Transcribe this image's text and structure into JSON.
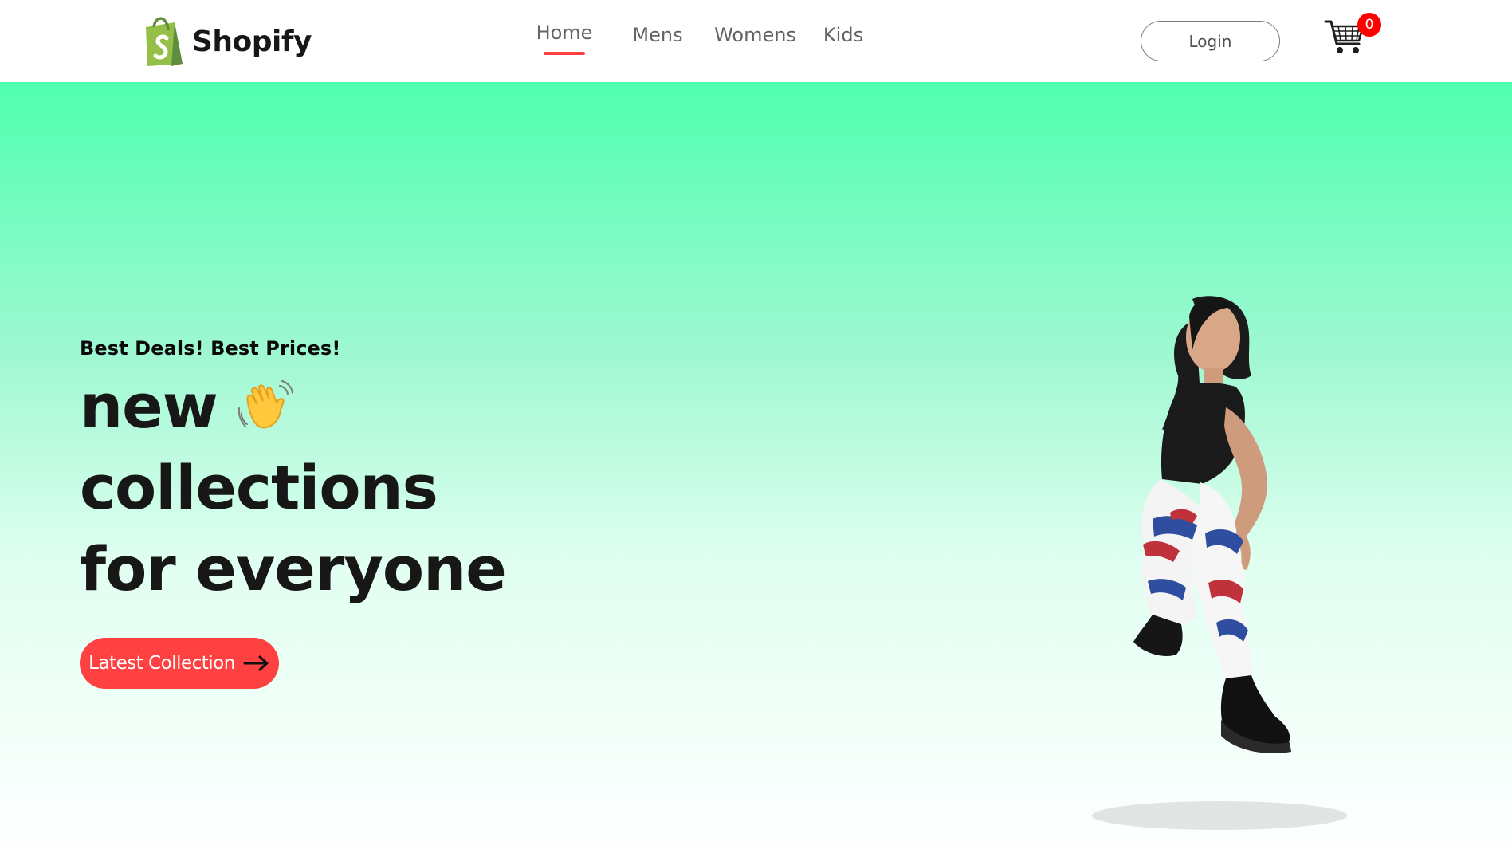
{
  "brand": {
    "name": "Shopify",
    "logo_icon": "shopping-bag-icon",
    "logo_color": "#5e8e3e"
  },
  "nav": {
    "items": [
      {
        "label": "Home",
        "active": true
      },
      {
        "label": "Mens",
        "active": false
      },
      {
        "label": "Womens",
        "active": false
      },
      {
        "label": "Kids",
        "active": false
      }
    ],
    "active_indicator_color": "#ff4141"
  },
  "header": {
    "login_label": "Login",
    "cart_icon": "shopping-cart-icon",
    "cart_count": "0",
    "cart_badge_color": "#ff0000"
  },
  "hero": {
    "tagline": "Best Deals! Best Prices!",
    "heading_line1": "new",
    "heading_icon": "waving-hand-icon",
    "heading_line2": "collections",
    "heading_line3": "for everyone",
    "button_label": "Latest Collection",
    "button_icon": "arrow-right-icon",
    "button_color": "#ff4141",
    "image": "hero-model-image",
    "gradient_colors": [
      "#4fffb0",
      "#ffffff"
    ]
  }
}
